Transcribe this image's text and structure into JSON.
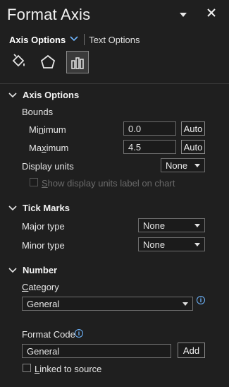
{
  "pane": {
    "title": "Format Axis",
    "menu_icon": "caret-down-icon",
    "close_icon": "close-icon"
  },
  "tabs": {
    "active": "Axis Options",
    "inactive": "Text Options"
  },
  "category_icons": [
    "fill-line-icon",
    "effects-pentagon-icon",
    "axis-options-bar-chart-icon"
  ],
  "axis_options": {
    "header": "Axis Options",
    "bounds_label": "Bounds",
    "minimum_label": [
      "Mi",
      "n",
      "imum"
    ],
    "minimum_value": "0.0",
    "minimum_button": "Auto",
    "maximum_label": [
      "Ma",
      "x",
      "imum"
    ],
    "maximum_value": "4.5",
    "maximum_button": "Auto",
    "display_units_label": "Display units",
    "display_units_value": "None",
    "show_units_label": [
      "S",
      "how display units label on chart"
    ]
  },
  "tick_marks": {
    "header": "Tick Marks",
    "major_label": "Major type",
    "major_value": "None",
    "minor_label": "Minor type",
    "minor_value": "None"
  },
  "number": {
    "header": "Number",
    "category_label": [
      "C",
      "ategory"
    ],
    "category_value": "General",
    "format_code_label": "Format Code",
    "format_code_value": "General",
    "add_button": "Add",
    "linked_label": [
      "L",
      "inked to source"
    ]
  },
  "colors": {
    "background": "#1f1f1f",
    "accent": "#6fb6ff",
    "text": "#e6e6e6",
    "disabled": "#6a6a6a"
  }
}
